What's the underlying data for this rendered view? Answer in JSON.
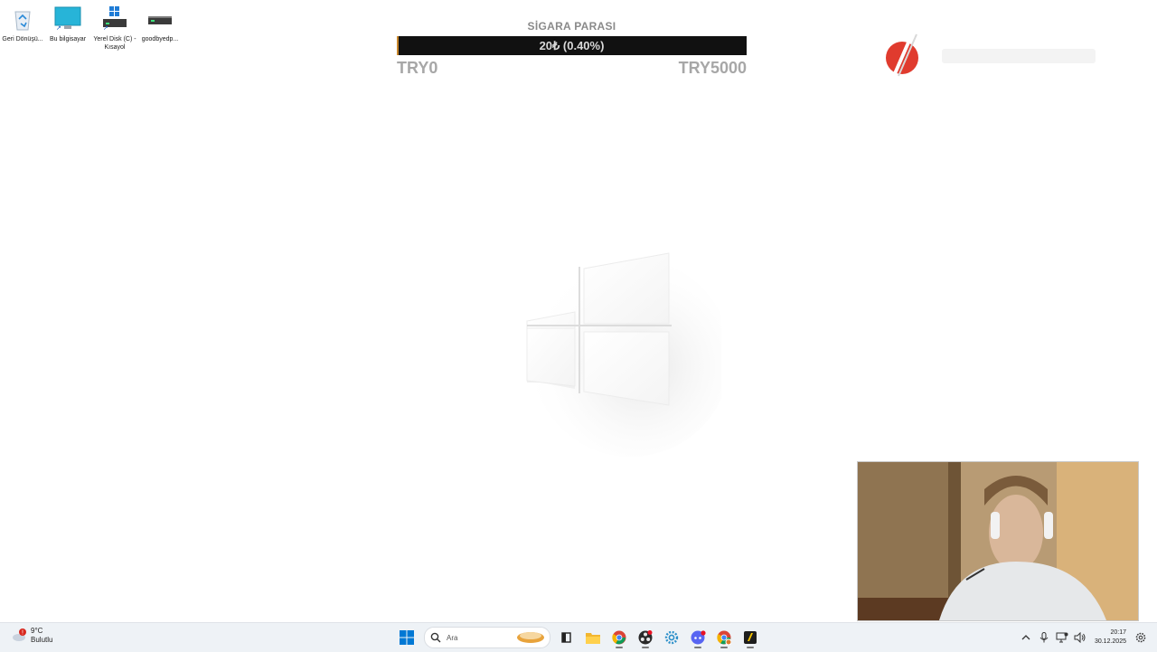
{
  "desktop": {
    "icons": [
      {
        "label": "Geri Dönüşü...",
        "icon": "recycle-bin-icon"
      },
      {
        "label": "Bu bilgisayar",
        "icon": "monitor-icon"
      },
      {
        "label": "Yerel Disk (C) - Kısayol",
        "icon": "drive-icon"
      },
      {
        "label": "goodbyedp...",
        "icon": "drive-icon"
      }
    ]
  },
  "goal": {
    "title": "SİGARA PARASI",
    "progress_text": "20₺ (0.40%)",
    "progress_percent": 0.4,
    "min_label": "TRY0",
    "max_label": "TRY5000",
    "fill_color": "#c8872c",
    "bar_color": "#111111"
  },
  "taskbar": {
    "weather": {
      "temp": "9°C",
      "condition": "Bulutlu",
      "alert_badge": "!"
    },
    "search_placeholder": "Ara",
    "apps": [
      "start-icon",
      "search-icon",
      "task-view-icon",
      "file-explorer-icon",
      "chrome-icon",
      "obs-icon",
      "settings-icon",
      "discord-icon",
      "chrome-profile-icon",
      "app-icon"
    ],
    "tray": {
      "time": "20:17",
      "date": "30.12.2025"
    }
  },
  "colors": {
    "accent_blue": "#0078d4",
    "logo_red": "#e03b2e"
  }
}
